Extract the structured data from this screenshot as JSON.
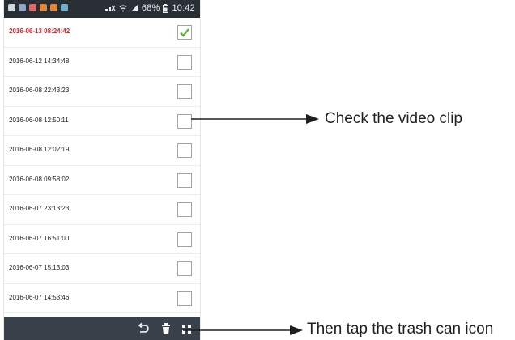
{
  "status_bar": {
    "battery": "68%",
    "time": "10:42",
    "left_icon_colors": [
      "#cfd6dc",
      "#8fa7c4",
      "#d96b6b",
      "#e0873a",
      "#e0873a",
      "#6fb0c9"
    ]
  },
  "clips": [
    {
      "timestamp": "2016-06-13 08:24:42",
      "checked": true,
      "highlight": true
    },
    {
      "timestamp": "2016-06-12 14:34:48",
      "checked": false
    },
    {
      "timestamp": "2016-06-08 22:43:23",
      "checked": false
    },
    {
      "timestamp": "2016-06-08 12:50:11",
      "checked": false
    },
    {
      "timestamp": "2016-06-08 12:02:19",
      "checked": false
    },
    {
      "timestamp": "2016-06-08 09:58:02",
      "checked": false
    },
    {
      "timestamp": "2016-06-07 23:13:23",
      "checked": false
    },
    {
      "timestamp": "2016-06-07 16:51:00",
      "checked": false
    },
    {
      "timestamp": "2016-06-07 15:13:03",
      "checked": false
    },
    {
      "timestamp": "2016-06-07 14:53:46",
      "checked": false
    }
  ],
  "bottom_bar": {
    "icons": [
      "back-icon",
      "trash-icon",
      "grid-icon"
    ]
  },
  "annotations": {
    "check": "Check the video clip",
    "trash": "Then tap the trash can icon"
  },
  "colors": {
    "highlight_text": "#e02424",
    "checkmark": "#5cb82d",
    "status_bar_bg": "#2a2f35",
    "bottom_bar_bg": "#39414a"
  }
}
